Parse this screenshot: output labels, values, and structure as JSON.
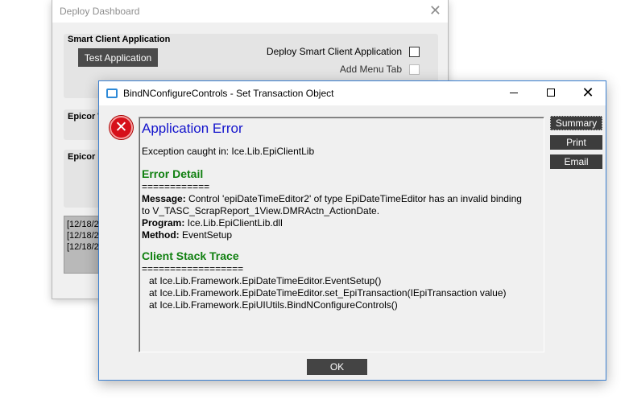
{
  "back_window": {
    "title": "Deploy Dashboard",
    "close_glyph": "✕",
    "group_smart_client": {
      "title": "Smart Client Application",
      "test_button": "Test Application",
      "deploy_checkbox_label": "Deploy Smart Client Application",
      "deploy_checked": false,
      "add_menu_tab_label": "Add Menu Tab",
      "add_menu_tab_enabled": false
    },
    "group_2_title": "Epicor W",
    "group_3_title": "Epicor N",
    "log_lines": [
      "[12/18/2",
      "[12/18/2",
      "[12/18/2"
    ]
  },
  "dialog": {
    "title": "BindNConfigureControls - Set Transaction Object",
    "icon": "error-icon",
    "icon_glyph": "✕",
    "close_glyph": "✕",
    "buttons": {
      "summary": "Summary",
      "print": "Print",
      "email": "Email",
      "ok": "OK"
    },
    "content": {
      "heading": "Application Error",
      "exception_line": "Exception caught in: Ice.Lib.EpiClientLib",
      "error_detail_heading": "Error Detail",
      "separator_1": "============",
      "message_label": "Message:",
      "message_text": " Control 'epiDateTimeEditor2' of type EpiDateTimeEditor has an invalid binding",
      "message_text_2": "to V_TASC_ScrapReport_1View.DMRActn_ActionDate.",
      "program_label": "Program:",
      "program_text": " Ice.Lib.EpiClientLib.dll",
      "method_label": "Method:",
      "method_text": " EventSetup",
      "stack_heading": "Client Stack Trace",
      "separator_2": "==================",
      "stack_lines": [
        "at Ice.Lib.Framework.EpiDateTimeEditor.EventSetup()",
        "at Ice.Lib.Framework.EpiDateTimeEditor.set_EpiTransaction(IEpiTransaction value)",
        "at Ice.Lib.Framework.EpiUIUtils.BindNConfigureControls()"
      ]
    }
  },
  "colors": {
    "heading_blue": "#1414cc",
    "heading_green": "#108010",
    "dialog_border": "#3a7fd0",
    "error_red": "#d6101a",
    "button_dark": "#444444"
  }
}
